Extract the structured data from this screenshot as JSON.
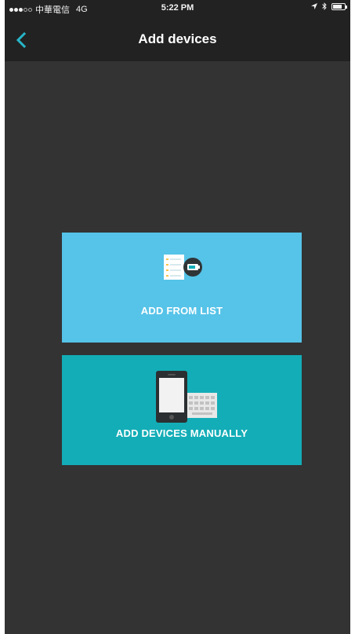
{
  "status_bar": {
    "carrier": "中華電信",
    "network": "4G",
    "time": "5:22 PM",
    "battery_level": 0.8
  },
  "nav": {
    "title": "Add devices",
    "back_icon": "chevron-left-icon",
    "accent_color": "#27b5c6"
  },
  "options": {
    "from_list": {
      "label": "ADD FROM LIST",
      "icon": "list-device-icon",
      "color": "#56c3e8"
    },
    "manual": {
      "label": "ADD DEVICES MANUALLY",
      "icon": "phone-keyboard-icon",
      "color": "#13adb7"
    }
  }
}
